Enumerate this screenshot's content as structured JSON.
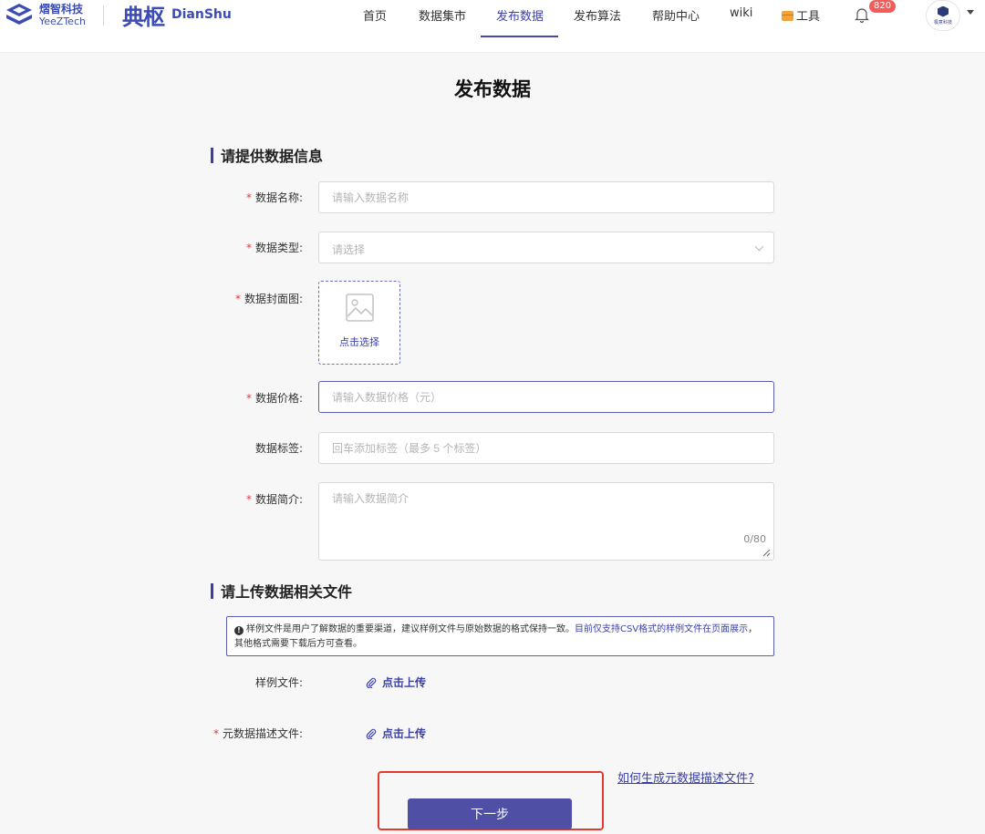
{
  "header": {
    "yz_logo_cn": "熠智科技",
    "yz_logo_en": "YeeZTech",
    "ds_logo_cn": "典枢",
    "ds_logo_en": "DianShu",
    "nav": [
      {
        "label": "首页"
      },
      {
        "label": "数据集市"
      },
      {
        "label": "发布数据",
        "active": true
      },
      {
        "label": "发布算法"
      },
      {
        "label": "帮助中心"
      },
      {
        "label": "wiki"
      },
      {
        "label": "工具",
        "icon": "toolbox-icon"
      }
    ],
    "notification_count": "820",
    "avatar_caption": "极意科技"
  },
  "page": {
    "title": "发布数据"
  },
  "section1": {
    "title": "请提供数据信息",
    "fields": {
      "name": {
        "label": "数据名称:",
        "required": true,
        "placeholder": "请输入数据名称"
      },
      "type": {
        "label": "数据类型:",
        "required": true,
        "placeholder": "请选择"
      },
      "cover": {
        "label": "数据封面图:",
        "required": true,
        "button": "点击选择"
      },
      "price": {
        "label": "数据价格:",
        "required": true,
        "placeholder": "请输入数据价格（元）"
      },
      "tags": {
        "label": "数据标签:",
        "required": false,
        "placeholder": "回车添加标签（最多 5 个标签）"
      },
      "intro": {
        "label": "数据简介:",
        "required": true,
        "placeholder": "请输入数据简介",
        "count": "0/80"
      }
    }
  },
  "section2": {
    "title": "请上传数据相关文件",
    "notice_text": "样例文件是用户了解数据的重要渠道，建议样例文件与原始数据的格式保持一致。",
    "notice_link": "目前仅支持CSV格式的样例文件在页面展示",
    "notice_tail": "，其他格式需要下载后方可查看。",
    "sample_label": "样例文件:",
    "sample_upload": "点击上传",
    "meta_label": "元数据描述文件:",
    "meta_upload": "点击上传",
    "help_link": "如何生成元数据描述文件?"
  },
  "actions": {
    "next": "下一步"
  },
  "colors": {
    "primary": "#3b3fa8",
    "button": "#4f4fa6",
    "required": "#e4393c",
    "highlight": "#e23a30",
    "badge": "#f45b5b"
  }
}
